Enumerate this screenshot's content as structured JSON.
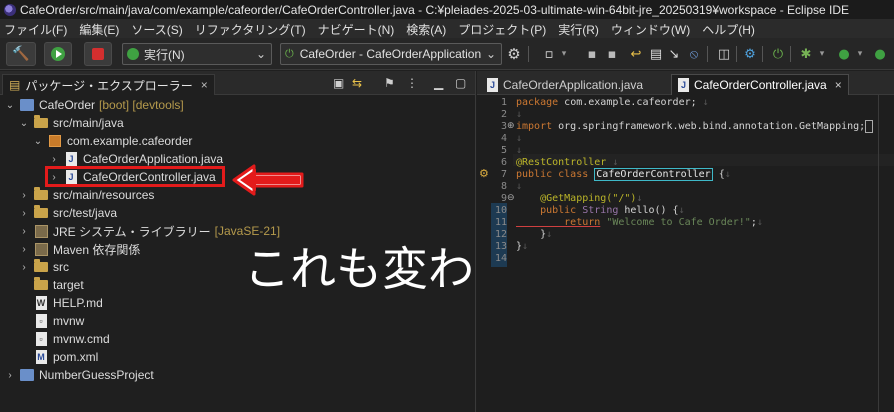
{
  "window": {
    "title": "CafeOrder/src/main/java/com/example/cafeorder/CafeOrderController.java - C:¥pleiades-2025-03-ultimate-win-64bit-jre_20250319¥workspace - Eclipse IDE"
  },
  "menu": [
    "ファイル(F)",
    "編集(E)",
    "ソース(S)",
    "リファクタリング(T)",
    "ナビゲート(N)",
    "検索(A)",
    "プロジェクト(P)",
    "実行(R)",
    "ウィンドウ(W)",
    "ヘルプ(H)"
  ],
  "toolbar": {
    "run_mode_label": "実行(N)",
    "launch_config_label": "CafeOrder - CafeOrderApplication"
  },
  "explorer": {
    "tab_label": "パッケージ・エクスプローラー",
    "tab_close": "×",
    "tree": [
      {
        "label": "CafeOrder",
        "suffix": "[boot] [devtools]"
      },
      {
        "label": "src/main/java"
      },
      {
        "label": "com.example.cafeorder"
      },
      {
        "label": "CafeOrderApplication.java"
      },
      {
        "label": "CafeOrderController.java"
      },
      {
        "label": "src/main/resources"
      },
      {
        "label": "src/test/java"
      },
      {
        "label": "JRE システム・ライブラリー",
        "suffix": "[JavaSE-21]"
      },
      {
        "label": "Maven 依存関係"
      },
      {
        "label": "src"
      },
      {
        "label": "target"
      },
      {
        "label": "HELP.md"
      },
      {
        "label": "mvnw"
      },
      {
        "label": "mvnw.cmd"
      },
      {
        "label": "pom.xml"
      },
      {
        "label": "NumberGuessProject"
      }
    ]
  },
  "overlay_caption": "これも変わる",
  "editor": {
    "tabs": [
      {
        "label": "CafeOrderApplication.java"
      },
      {
        "label": "CafeOrderController.java",
        "close": "×"
      }
    ],
    "line_numbers": [
      "1",
      "2",
      "3",
      "4",
      "5",
      "6",
      "7",
      "8",
      "9",
      "10",
      "11",
      "12",
      "13",
      "14"
    ],
    "code": {
      "l1_kw": "package",
      "l1_rest": " com.example.cafeorder;",
      "l3_kw": "import",
      "l3_rest": " org.springframework.web.bind.annotation.GetMapping;",
      "l6": "@RestController",
      "l7_kw": "public class",
      "l7_cls": "CafeOrderController",
      "l7_rest": " {",
      "l9": "    @GetMapping(\"/\")",
      "l10_kw": "    public",
      "l10_typ": " String",
      "l10_rest": " hello() {",
      "l11_kw": "        return",
      "l11_str": " \"Welcome to Cafe Order!\"",
      "l11_rest": ";",
      "l12": "    }",
      "l13": "}"
    }
  }
}
